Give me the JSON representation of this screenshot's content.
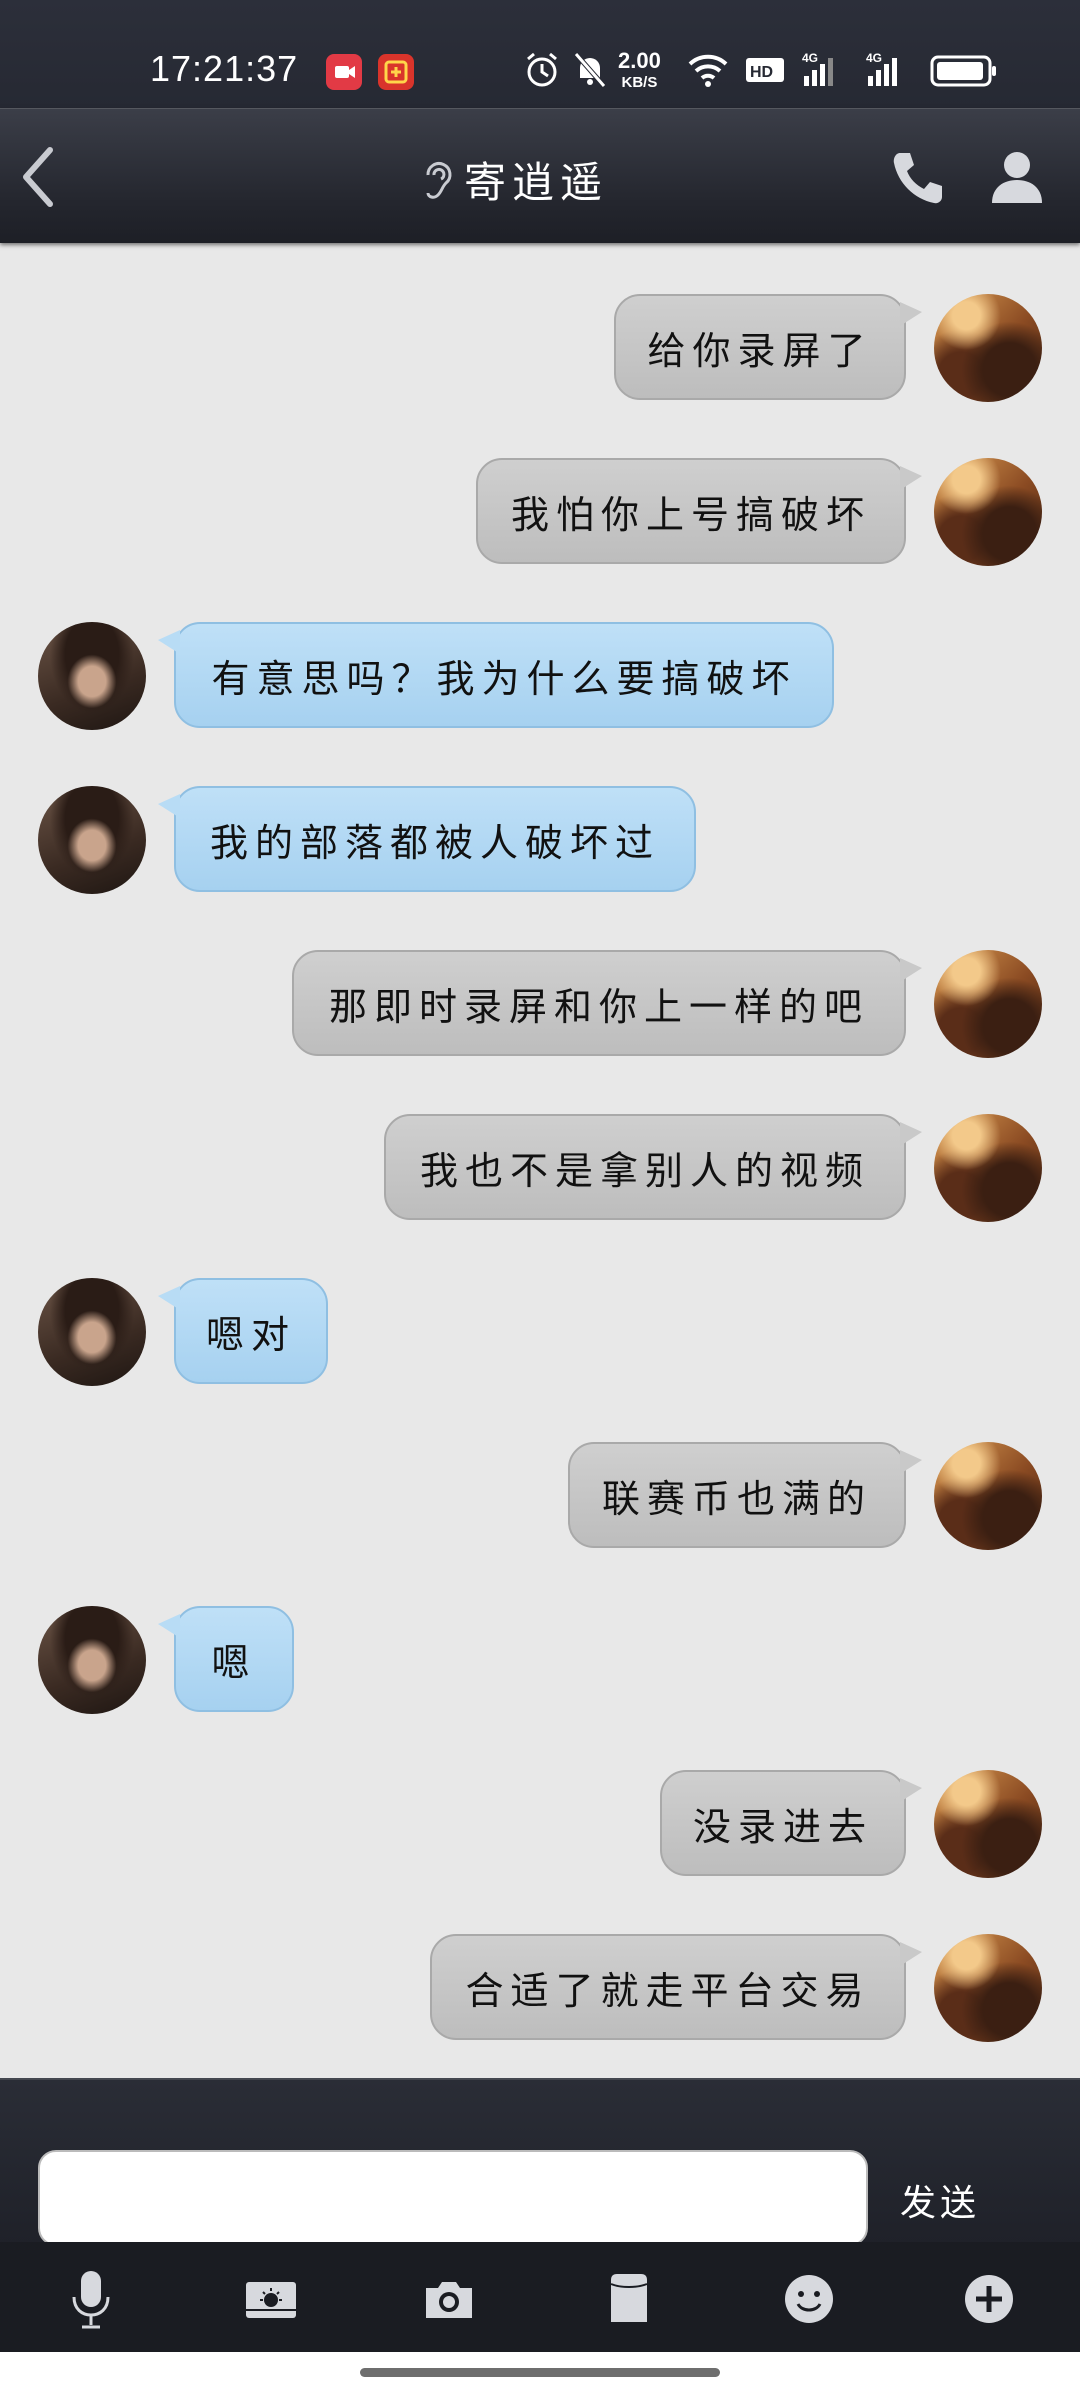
{
  "status": {
    "time": "17:21:37",
    "net_speed_value": "2.00",
    "net_speed_unit": "KB/S"
  },
  "header": {
    "title": "寄逍遥"
  },
  "messages": [
    {
      "side": "out",
      "text": "给你录屏了"
    },
    {
      "side": "out",
      "text": "我怕你上号搞破坏"
    },
    {
      "side": "in",
      "text": "有意思吗？我为什么要搞破坏"
    },
    {
      "side": "in",
      "text": "我的部落都被人破坏过"
    },
    {
      "side": "out",
      "text": "那即时录屏和你上一样的吧"
    },
    {
      "side": "out",
      "text": "我也不是拿别人的视频"
    },
    {
      "side": "in",
      "text": "嗯对"
    },
    {
      "side": "out",
      "text": "联赛币也满的"
    },
    {
      "side": "in",
      "text": "嗯"
    },
    {
      "side": "out",
      "text": "没录进去"
    },
    {
      "side": "out",
      "text": "合适了就走平台交易"
    }
  ],
  "input": {
    "value": "",
    "send_label": "发送"
  },
  "toolbar": [
    "microphone-icon",
    "image-icon",
    "camera-icon",
    "card-icon",
    "emoji-icon",
    "plus-icon"
  ],
  "colors": {
    "outgoing_bubble": "#c6c6c6",
    "incoming_bubble": "#add6f3",
    "background": "#e8e8e8",
    "header": "#24262e"
  }
}
